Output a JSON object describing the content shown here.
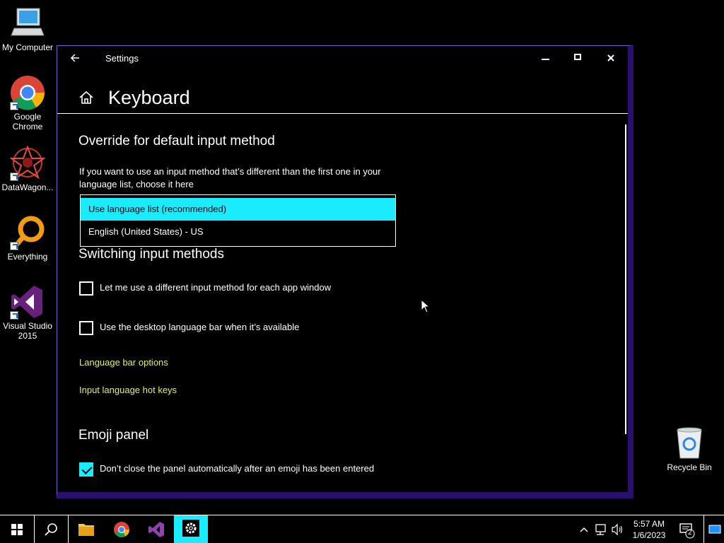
{
  "desktop": {
    "icons": [
      {
        "label": "My Computer"
      },
      {
        "label": "Google Chrome"
      },
      {
        "label": "DataWagon..."
      },
      {
        "label": "Everything"
      },
      {
        "label": "Visual Studio 2015"
      },
      {
        "label": "Recycle Bin"
      }
    ]
  },
  "window": {
    "title": "Settings",
    "back_icon": "back-arrow-icon",
    "page_title": "Keyboard"
  },
  "override": {
    "title": "Override for default input method",
    "description": "If you want to use an input method that’s different than the first one in your language list, choose it here",
    "options": [
      {
        "label": "Use language list (recommended)",
        "selected": true
      },
      {
        "label": "English (United States) - US",
        "selected": false
      }
    ]
  },
  "switching": {
    "title": "Switching input methods",
    "checkboxes": [
      {
        "label": "Let me use a different input method for each app window",
        "checked": false
      },
      {
        "label": "Use the desktop language bar when it’s available",
        "checked": false
      }
    ],
    "links": [
      {
        "label": "Language bar options"
      },
      {
        "label": "Input language hot keys"
      }
    ]
  },
  "emoji": {
    "title": "Emoji panel",
    "checkbox": {
      "label": "Don’t close the panel automatically after an emoji has been entered",
      "checked": true
    }
  },
  "taskbar": {
    "clock_time": "5:57 AM",
    "clock_date": "1/6/2023",
    "notification_count": "2"
  },
  "colors": {
    "accent": "#1aebff",
    "link": "#e6f05a",
    "window_border": "#2b0f6e"
  }
}
